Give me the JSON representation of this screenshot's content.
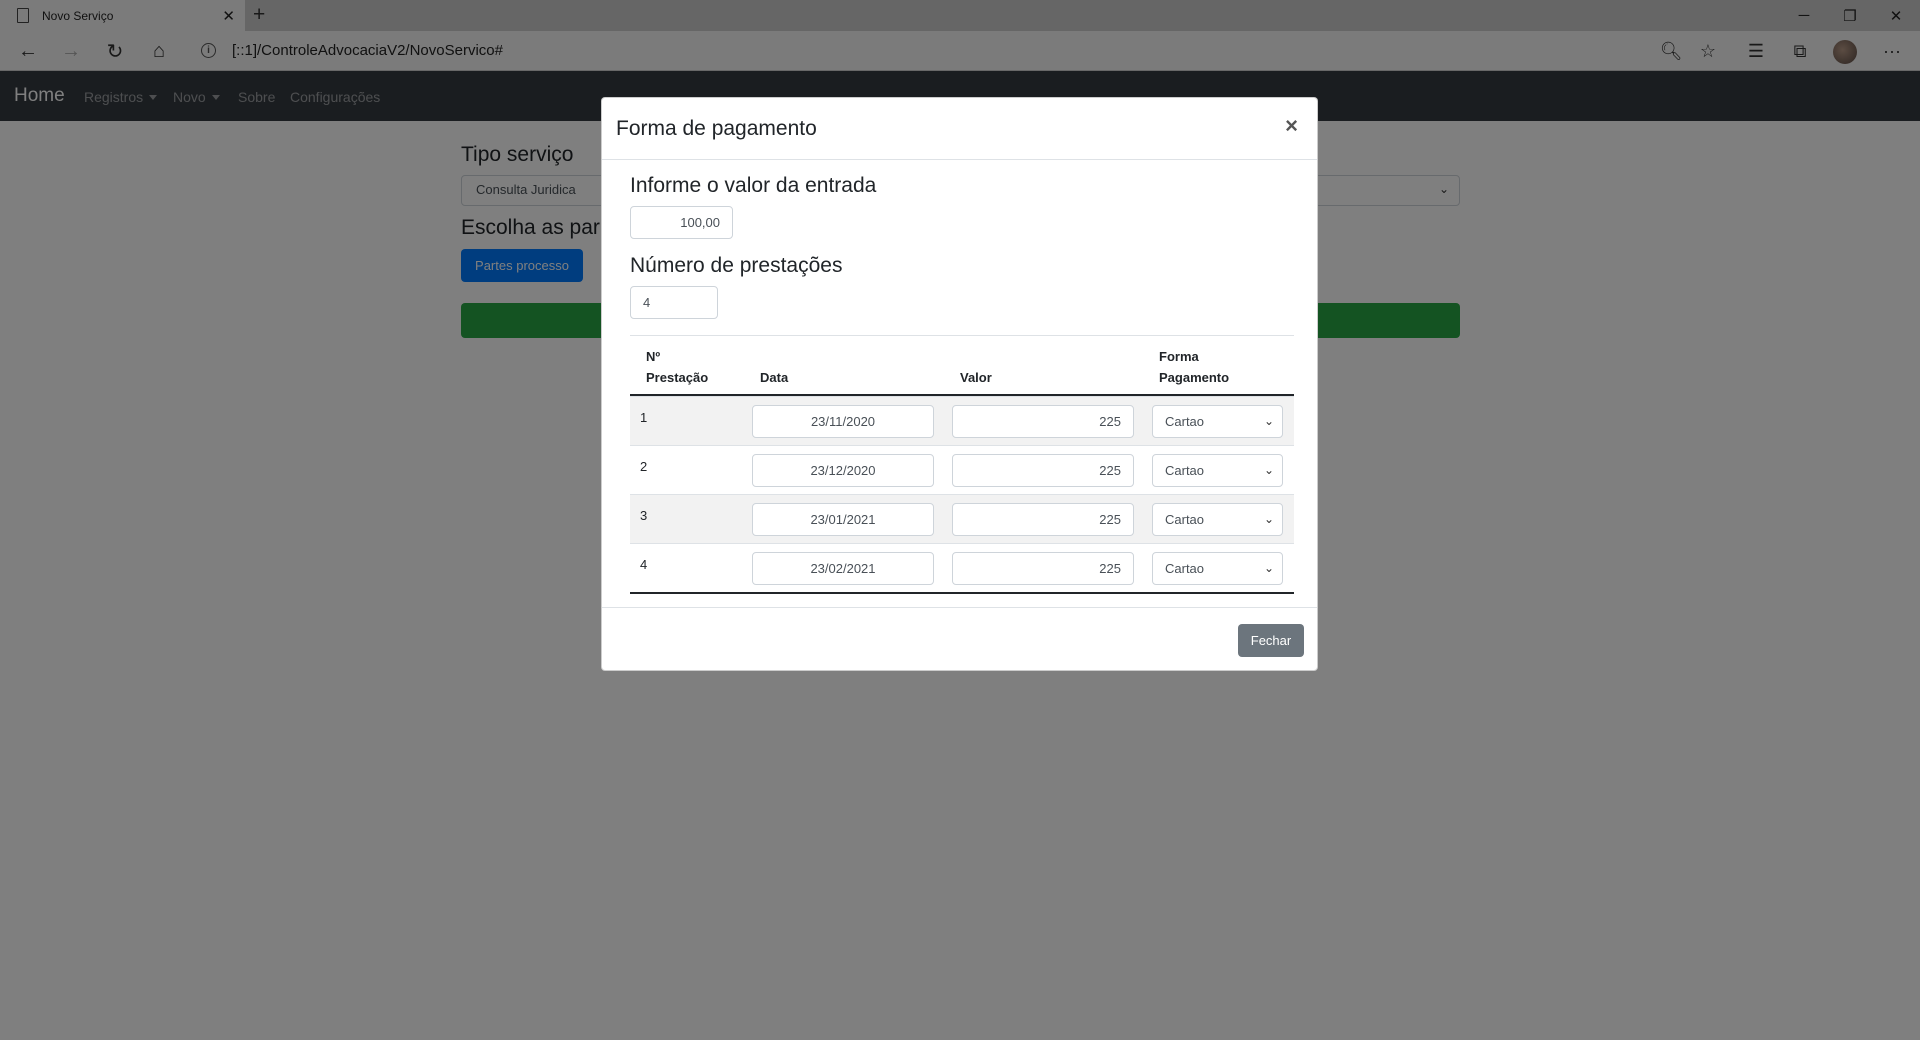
{
  "browser": {
    "tab_title": "Novo Serviço",
    "tab_close": "✕",
    "new_tab": "+",
    "url": "[::1]/ControleAdvocaciaV2/NovoServico#",
    "info": "i",
    "controls": {
      "minimize": "─",
      "restore": "❐",
      "close": "✕"
    },
    "icons": {
      "back": "←",
      "forward": "→",
      "refresh": "↻",
      "home": "⌂",
      "zoom": "🔍︎",
      "favorite": "☆",
      "favorites_list": "☰",
      "collections": "⧉",
      "more": "···"
    }
  },
  "app_nav": {
    "brand": "Home",
    "links": [
      "Registros",
      "Novo",
      "Sobre",
      "Configurações"
    ]
  },
  "page": {
    "title": "Tipo serviço",
    "select_value": "Consulta Juridica",
    "subtitle": "Escolha as par",
    "button": "Partes processo"
  },
  "modal": {
    "title": "Forma de pagamento",
    "close": "×",
    "entrada_label": "Informe o valor da entrada",
    "entrada_value": "100,00",
    "prestacoes_label": "Número de prestações",
    "prestacoes_value": "4",
    "table": {
      "headers": {
        "num_line1": "Nº",
        "num_line2": "Prestação",
        "data": "Data",
        "valor": "Valor",
        "forma_line1": "Forma",
        "forma_line2": "Pagamento"
      },
      "rows": [
        {
          "num": "1",
          "data": "23/11/2020",
          "valor": "225",
          "forma": "Cartao"
        },
        {
          "num": "2",
          "data": "23/12/2020",
          "valor": "225",
          "forma": "Cartao"
        },
        {
          "num": "3",
          "data": "23/01/2021",
          "valor": "225",
          "forma": "Cartao"
        },
        {
          "num": "4",
          "data": "23/02/2021",
          "valor": "225",
          "forma": "Cartao"
        }
      ]
    },
    "footer_button": "Fechar"
  },
  "colors": {
    "navbar": "#343a40",
    "primary": "#007bff",
    "success": "#28a745",
    "secondary": "#6c757d"
  }
}
